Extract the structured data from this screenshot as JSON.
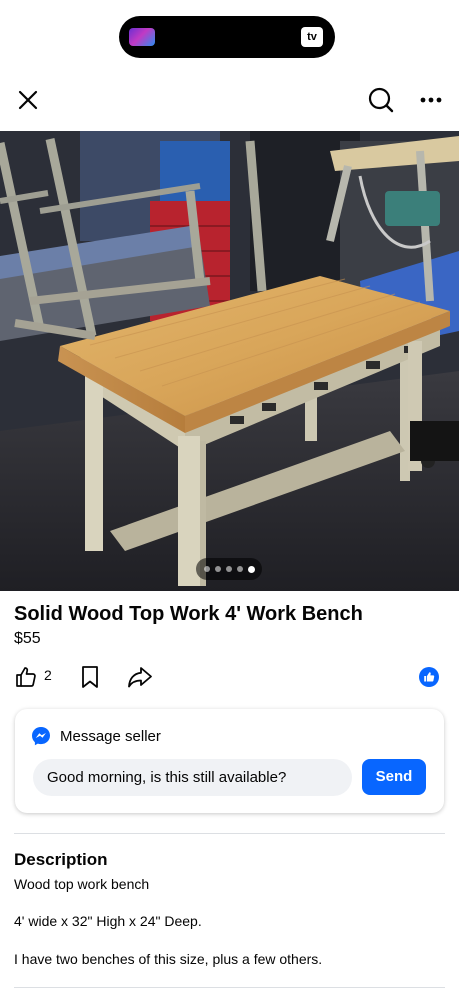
{
  "status_bar": {
    "now_playing_icon": "album-art-icon",
    "app_badge": "tv"
  },
  "nav": {
    "close_icon": "close-icon",
    "search_icon": "search-icon",
    "more_icon": "more-icon"
  },
  "listing": {
    "photo_description_icon": "listing-photo",
    "photo_count": 5,
    "photo_active_index": 5,
    "title": "Solid Wood Top Work 4' Work Bench",
    "price": "$55",
    "like_count": "2"
  },
  "messaging": {
    "header": "Message seller",
    "input_value": "Good morning, is this still available?",
    "send_label": "Send"
  },
  "description": {
    "heading": "Description",
    "lines": [
      "Wood top work bench",
      "4' wide x 32\" High x 24\" Deep.",
      "I have two benches of this size, plus a few others."
    ]
  },
  "colors": {
    "accent": "#0866ff",
    "text": "#050505",
    "input_bg": "#f0f2f5"
  }
}
